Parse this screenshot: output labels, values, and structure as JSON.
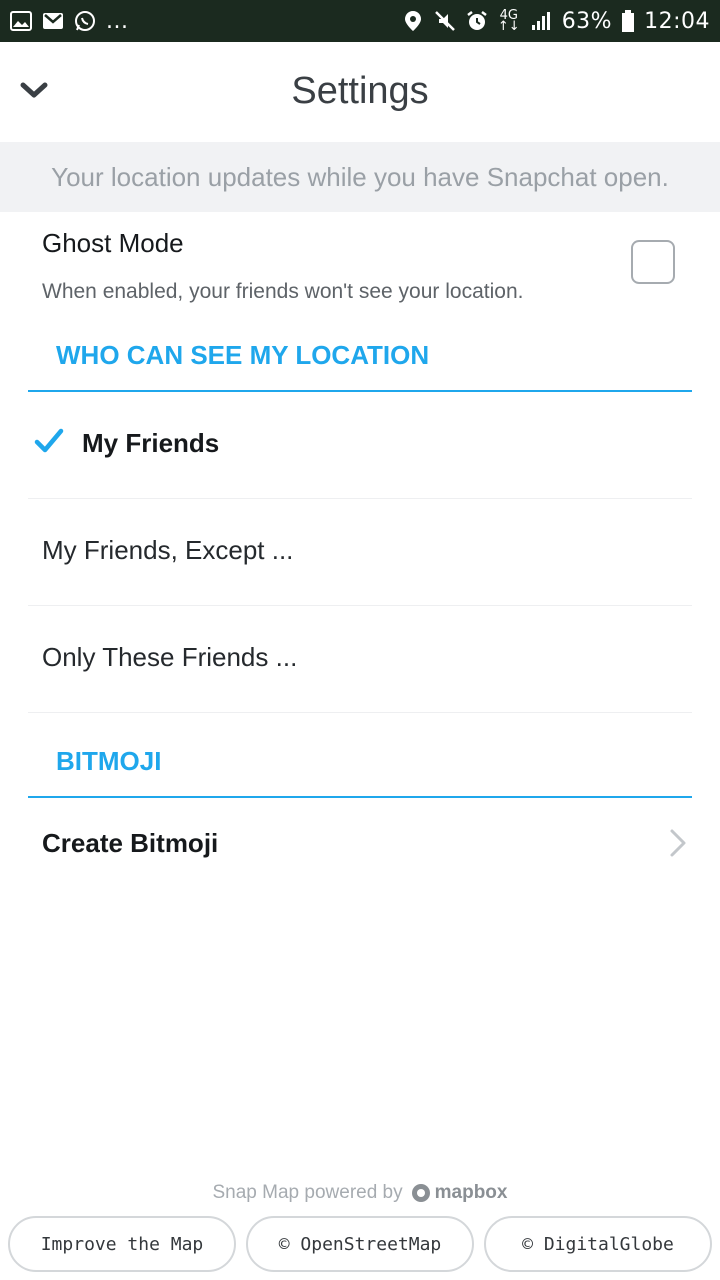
{
  "status_bar": {
    "left_icons": [
      "gallery-icon",
      "gmail-icon",
      "whatsapp-icon"
    ],
    "more": "...",
    "right_icons": [
      "location-icon",
      "mute-icon",
      "alarm-icon"
    ],
    "network_top": "4G",
    "network_bottom": "↑↓",
    "battery": "63%",
    "time": "12:04"
  },
  "header": {
    "title": "Settings"
  },
  "banner": {
    "text": "Your location updates while you have Snapchat open."
  },
  "ghost_mode": {
    "title": "Ghost Mode",
    "description": "When enabled, your friends won't see your location.",
    "checked": false
  },
  "sections": {
    "location": {
      "header": "WHO CAN SEE MY LOCATION",
      "options": [
        {
          "label": "My Friends",
          "selected": true
        },
        {
          "label": "My Friends, Except ...",
          "selected": false
        },
        {
          "label": "Only These Friends ...",
          "selected": false
        }
      ]
    },
    "bitmoji": {
      "header": "BITMOJI",
      "create_label": "Create Bitmoji"
    }
  },
  "footer": {
    "powered_by": "Snap Map powered by",
    "brand": "mapbox",
    "buttons": [
      "Improve the Map",
      "© OpenStreetMap",
      "© DigitalGlobe"
    ]
  },
  "colors": {
    "accent": "#1fa7ec",
    "status_bar": "#1b2a1f",
    "banner_bg": "#f1f2f4"
  }
}
